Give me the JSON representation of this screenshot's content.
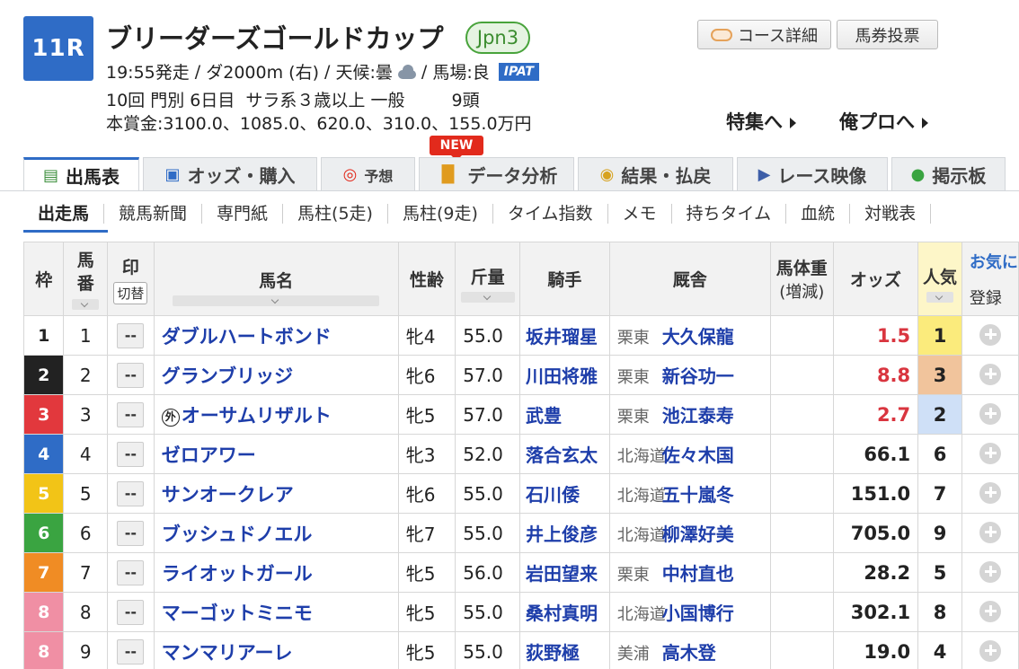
{
  "header": {
    "race_no": "11R",
    "race_name": "ブリーダーズゴールドカップ",
    "grade": "Jpn3",
    "start_time": "19:55発走",
    "course": "ダ2000m (右)",
    "weather_label": "天候:曇",
    "track_label": "馬場:良",
    "ipat_label": "IPAT",
    "meeting": "10回 門別 6日目",
    "conditions": "サラ系３歳以上 一般",
    "field_size": "9頭",
    "prize": "本賞金:3100.0、1085.0、620.0、310.0、155.0万円",
    "course_detail_label": "コース詳細",
    "vote_label": "馬券投票",
    "special_link": "特集へ",
    "pro_link": "俺プロへ",
    "weather_icon": "cloud-icon"
  },
  "tabs": [
    {
      "label": "出馬表",
      "icon": "table-icon"
    },
    {
      "label": "オッズ・購入",
      "icon": "odds-icon"
    },
    {
      "label": "予想",
      "icon": "target-icon"
    },
    {
      "label": "データ分析",
      "icon": "bar-chart-icon"
    },
    {
      "label": "結果・払戻",
      "icon": "coins-icon"
    },
    {
      "label": "レース映像",
      "icon": "video-icon"
    },
    {
      "label": "掲示板",
      "icon": "chat-icon"
    }
  ],
  "new_badge": "NEW",
  "subtabs": [
    "出走馬",
    "競馬新聞",
    "専門紙",
    "馬柱(5走)",
    "馬柱(9走)",
    "タイム指数",
    "メモ",
    "持ちタイム",
    "血統",
    "対戦表"
  ],
  "table": {
    "headers": {
      "waku": "枠",
      "umaban": "馬番",
      "mark": "印",
      "switch": "切替",
      "name": "馬名",
      "sexage": "性齢",
      "kinryo": "斤量",
      "jockey": "騎手",
      "stable": "厩舎",
      "weight_top": "馬体重",
      "weight_bottom": "(増減)",
      "odds": "オッズ",
      "ninki": "人気",
      "fav": "お気に",
      "register": "登録"
    },
    "rows": [
      {
        "waku": "1",
        "umaban": "1",
        "mark": "--",
        "prefix": "",
        "name": "ダブルハートボンド",
        "sexage": "牝4",
        "kinryo": "55.0",
        "jockey": "坂井瑠星",
        "area": "栗東",
        "trainer": "大久保龍",
        "odds": "1.5",
        "ninki": "1"
      },
      {
        "waku": "2",
        "umaban": "2",
        "mark": "--",
        "prefix": "",
        "name": "グランブリッジ",
        "sexage": "牝6",
        "kinryo": "57.0",
        "jockey": "川田将雅",
        "area": "栗東",
        "trainer": "新谷功一",
        "odds": "8.8",
        "ninki": "3"
      },
      {
        "waku": "3",
        "umaban": "3",
        "mark": "--",
        "prefix": "外",
        "name": "オーサムリザルト",
        "sexage": "牝5",
        "kinryo": "57.0",
        "jockey": "武豊",
        "area": "栗東",
        "trainer": "池江泰寿",
        "odds": "2.7",
        "ninki": "2"
      },
      {
        "waku": "4",
        "umaban": "4",
        "mark": "--",
        "prefix": "",
        "name": "ゼロアワー",
        "sexage": "牝3",
        "kinryo": "52.0",
        "jockey": "落合玄太",
        "area": "北海道",
        "trainer": "佐々木国",
        "odds": "66.1",
        "ninki": "6"
      },
      {
        "waku": "5",
        "umaban": "5",
        "mark": "--",
        "prefix": "",
        "name": "サンオークレア",
        "sexage": "牝6",
        "kinryo": "55.0",
        "jockey": "石川倭",
        "area": "北海道",
        "trainer": "五十嵐冬",
        "odds": "151.0",
        "ninki": "7"
      },
      {
        "waku": "6",
        "umaban": "6",
        "mark": "--",
        "prefix": "",
        "name": "ブッシュドノエル",
        "sexage": "牝7",
        "kinryo": "55.0",
        "jockey": "井上俊彦",
        "area": "北海道",
        "trainer": "柳澤好美",
        "odds": "705.0",
        "ninki": "9"
      },
      {
        "waku": "7",
        "umaban": "7",
        "mark": "--",
        "prefix": "",
        "name": "ライオットガール",
        "sexage": "牝5",
        "kinryo": "56.0",
        "jockey": "岩田望来",
        "area": "栗東",
        "trainer": "中村直也",
        "odds": "28.2",
        "ninki": "5"
      },
      {
        "waku": "8",
        "umaban": "8",
        "mark": "--",
        "prefix": "",
        "name": "マーゴットミニモ",
        "sexage": "牝5",
        "kinryo": "55.0",
        "jockey": "桑村真明",
        "area": "北海道",
        "trainer": "小国博行",
        "odds": "302.1",
        "ninki": "8"
      },
      {
        "waku": "8",
        "umaban": "9",
        "mark": "--",
        "prefix": "",
        "name": "マンマリアーレ",
        "sexage": "牝5",
        "kinryo": "55.0",
        "jockey": "荻野極",
        "area": "美浦",
        "trainer": "高木登",
        "odds": "19.0",
        "ninki": "4"
      }
    ]
  },
  "colors": {
    "accent": "#2f6cc6",
    "link": "#1e3eaa",
    "hot_odds": "#d9353f",
    "waku": [
      "#ffffff",
      "#222222",
      "#e2383d",
      "#2f6cc6",
      "#f2c417",
      "#3aa441",
      "#f08c24",
      "#f08fa4"
    ],
    "ninki_1": "#fbeb7c",
    "ninki_2": "#cfe0f7",
    "ninki_3": "#f1c49c"
  }
}
